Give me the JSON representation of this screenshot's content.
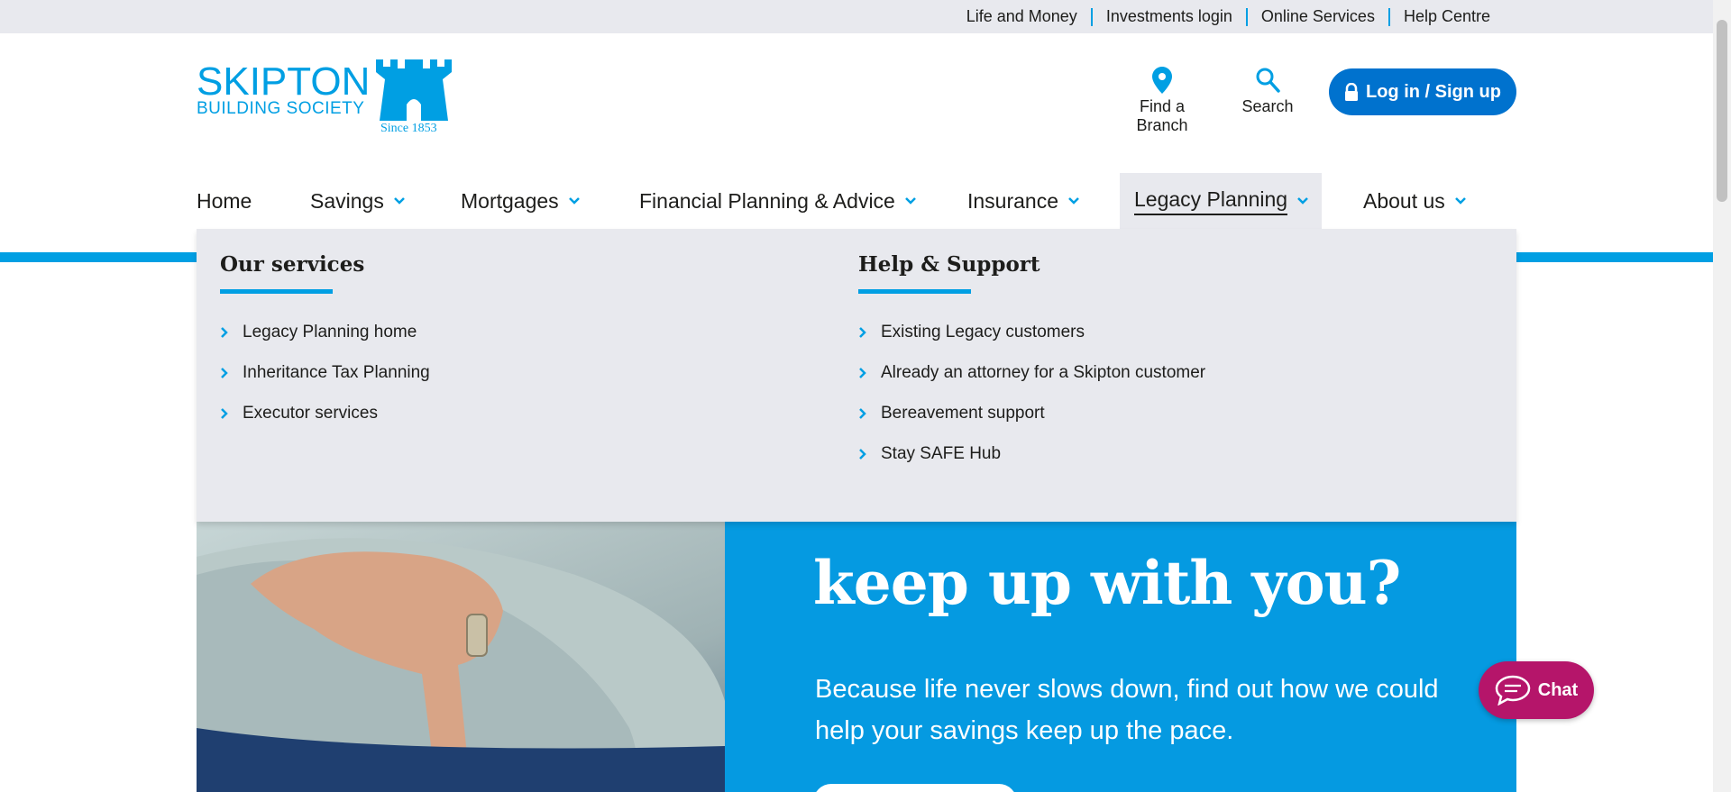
{
  "utility": {
    "links": [
      "Life and Money",
      "Investments login",
      "Online Services",
      "Help Centre"
    ]
  },
  "logo": {
    "line1": "SKIPTON",
    "line2": "BUILDING SOCIETY",
    "since": "Since 1853"
  },
  "header": {
    "find_branch": "Find a Branch",
    "search": "Search",
    "login": "Log in / Sign up"
  },
  "nav": {
    "items": [
      {
        "label": "Home"
      },
      {
        "label": "Savings"
      },
      {
        "label": "Mortgages"
      },
      {
        "label": "Financial Planning & Advice"
      },
      {
        "label": "Insurance"
      },
      {
        "label": "Legacy Planning"
      },
      {
        "label": "About us"
      }
    ],
    "active": "Legacy Planning"
  },
  "mega_menu": {
    "our_services": {
      "heading": "Our services",
      "links": [
        "Legacy Planning home",
        "Inheritance Tax Planning",
        "Executor services"
      ]
    },
    "help_support": {
      "heading": "Help & Support",
      "links": [
        "Existing Legacy customers",
        "Already an attorney for a Skipton customer",
        "Bereavement support",
        "Stay SAFE Hub"
      ]
    }
  },
  "hero": {
    "title": "keep up with you?",
    "body": "Because life never slows down, find out how we could help your savings keep up the pace."
  },
  "chat": {
    "label": "Chat"
  },
  "colors": {
    "brand_blue": "#009fe3",
    "button_blue": "#0072ce",
    "hero_blue": "#059ae1",
    "chat_magenta": "#b5156a",
    "menu_bg": "#e8e9ee"
  }
}
